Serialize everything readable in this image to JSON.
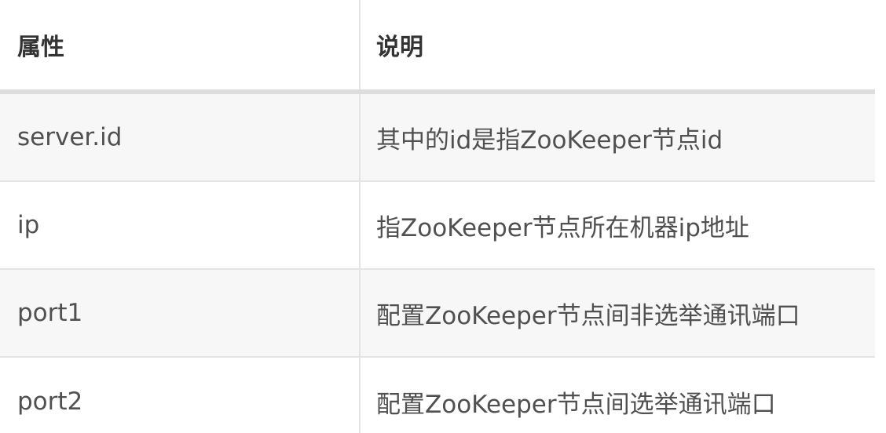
{
  "table": {
    "headers": [
      "属性",
      "说明"
    ],
    "rows": [
      [
        "server.id",
        "其中的id是指ZooKeeper节点id"
      ],
      [
        "ip",
        "指ZooKeeper节点所在机器ip地址"
      ],
      [
        "port1",
        "配置ZooKeeper节点间非选举通讯端口"
      ],
      [
        "port2",
        "配置ZooKeeper节点间选举通讯端口"
      ]
    ]
  }
}
